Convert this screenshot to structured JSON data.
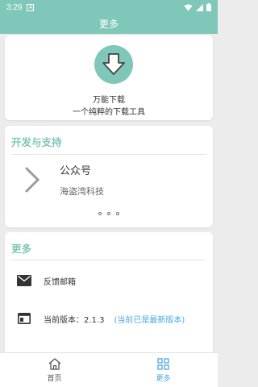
{
  "status": {
    "time": "3:29",
    "indicator": "A"
  },
  "appbar": {
    "title": "更多"
  },
  "hero": {
    "app_name": "万能下载",
    "description": "一个纯粹的下载工具",
    "accent": "#7fc7b8",
    "icon": "download-icon"
  },
  "dev": {
    "section_title": "开发与支持",
    "account_type": "公众号",
    "account_name": "海盗湾科技",
    "pager_dots": 3
  },
  "more": {
    "section_title": "更多",
    "items": [
      {
        "icon": "mail-icon",
        "label": "反馈邮箱"
      },
      {
        "icon": "version-icon",
        "label": "当前版本：2.1.3",
        "note": "(当前已是最新版本)"
      }
    ]
  },
  "tabs": [
    {
      "icon": "home-icon",
      "label": "首页",
      "active": false
    },
    {
      "icon": "grid-icon",
      "label": "更多",
      "active": true
    }
  ],
  "colors": {
    "primary": "#7fc7b8",
    "link": "#4aa8e0"
  }
}
